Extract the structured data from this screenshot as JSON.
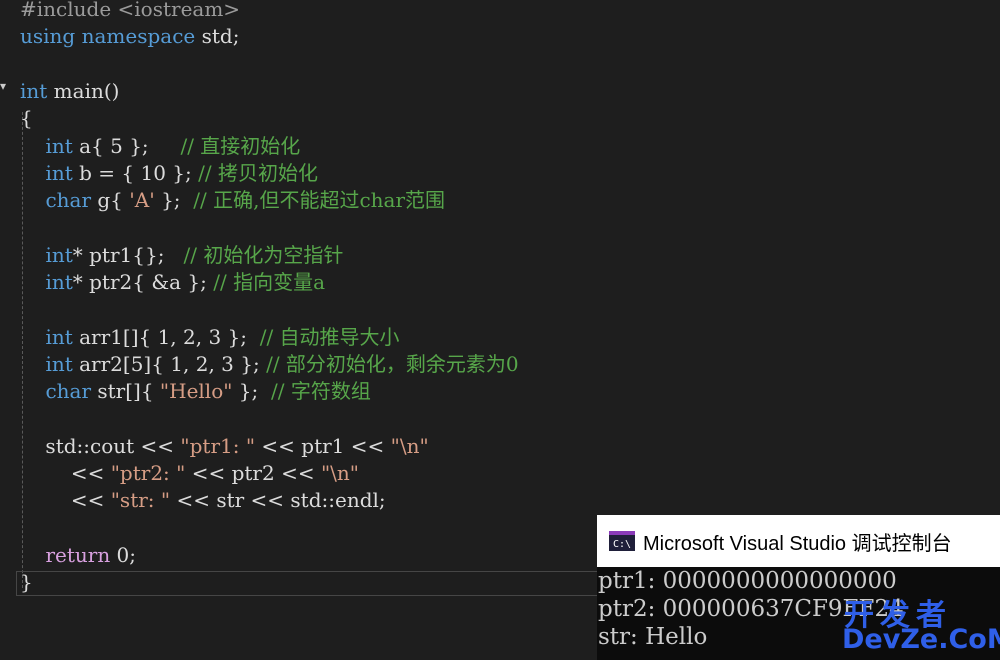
{
  "editor": {
    "lines": [
      {
        "tokens": [
          {
            "t": "#include <iostream>",
            "c": "pre"
          }
        ]
      },
      {
        "tokens": [
          {
            "t": "using",
            "c": "kw"
          },
          {
            "t": " ",
            "c": "ident"
          },
          {
            "t": "namespace",
            "c": "kw"
          },
          {
            "t": " std;",
            "c": "ident"
          }
        ]
      },
      {
        "tokens": []
      },
      {
        "tokens": [
          {
            "t": "int",
            "c": "kw"
          },
          {
            "t": " main()",
            "c": "ident"
          }
        ]
      },
      {
        "tokens": [
          {
            "t": "{",
            "c": "ident"
          }
        ]
      },
      {
        "tokens": [
          {
            "t": "    ",
            "c": "ident"
          },
          {
            "t": "int",
            "c": "kw"
          },
          {
            "t": " a{ 5 };     ",
            "c": "ident"
          },
          {
            "t": "// 直接初始化",
            "c": "cmt"
          }
        ]
      },
      {
        "tokens": [
          {
            "t": "    ",
            "c": "ident"
          },
          {
            "t": "int",
            "c": "kw"
          },
          {
            "t": " b = { 10 }; ",
            "c": "ident"
          },
          {
            "t": "// 拷贝初始化",
            "c": "cmt"
          }
        ]
      },
      {
        "tokens": [
          {
            "t": "    ",
            "c": "ident"
          },
          {
            "t": "char",
            "c": "kw"
          },
          {
            "t": " g{ ",
            "c": "ident"
          },
          {
            "t": "'A'",
            "c": "str"
          },
          {
            "t": " };  ",
            "c": "ident"
          },
          {
            "t": "// 正确,但不能超过char范围",
            "c": "cmt"
          }
        ]
      },
      {
        "tokens": []
      },
      {
        "tokens": [
          {
            "t": "    ",
            "c": "ident"
          },
          {
            "t": "int",
            "c": "kw"
          },
          {
            "t": "* ptr1{};   ",
            "c": "ident"
          },
          {
            "t": "// 初始化为空指针",
            "c": "cmt"
          }
        ]
      },
      {
        "tokens": [
          {
            "t": "    ",
            "c": "ident"
          },
          {
            "t": "int",
            "c": "kw"
          },
          {
            "t": "* ptr2{ &a }; ",
            "c": "ident"
          },
          {
            "t": "// 指向变量a",
            "c": "cmt"
          }
        ]
      },
      {
        "tokens": []
      },
      {
        "tokens": [
          {
            "t": "    ",
            "c": "ident"
          },
          {
            "t": "int",
            "c": "kw"
          },
          {
            "t": " arr1[]{ 1, 2, 3 };  ",
            "c": "ident"
          },
          {
            "t": "// 自动推导大小",
            "c": "cmt"
          }
        ]
      },
      {
        "tokens": [
          {
            "t": "    ",
            "c": "ident"
          },
          {
            "t": "int",
            "c": "kw"
          },
          {
            "t": " arr2[5]{ 1, 2, 3 }; ",
            "c": "ident"
          },
          {
            "t": "// 部分初始化，剩余元素为0",
            "c": "cmt"
          }
        ]
      },
      {
        "tokens": [
          {
            "t": "    ",
            "c": "ident"
          },
          {
            "t": "char",
            "c": "kw"
          },
          {
            "t": " str[]{ ",
            "c": "ident"
          },
          {
            "t": "\"Hello\"",
            "c": "str"
          },
          {
            "t": " };  ",
            "c": "ident"
          },
          {
            "t": "// 字符数组",
            "c": "cmt"
          }
        ]
      },
      {
        "tokens": []
      },
      {
        "tokens": [
          {
            "t": "    std::cout << ",
            "c": "ident"
          },
          {
            "t": "\"ptr1: \"",
            "c": "str"
          },
          {
            "t": " << ptr1 << ",
            "c": "ident"
          },
          {
            "t": "\"\\n\"",
            "c": "str"
          }
        ]
      },
      {
        "tokens": [
          {
            "t": "        << ",
            "c": "ident"
          },
          {
            "t": "\"ptr2: \"",
            "c": "str"
          },
          {
            "t": " << ptr2 << ",
            "c": "ident"
          },
          {
            "t": "\"\\n\"",
            "c": "str"
          }
        ]
      },
      {
        "tokens": [
          {
            "t": "        << ",
            "c": "ident"
          },
          {
            "t": "\"str: \"",
            "c": "str"
          },
          {
            "t": " << str << std::endl;",
            "c": "ident"
          }
        ]
      },
      {
        "tokens": []
      },
      {
        "tokens": [
          {
            "t": "    ",
            "c": "ident"
          },
          {
            "t": "return",
            "c": "ret"
          },
          {
            "t": " 0;",
            "c": "ident"
          }
        ]
      },
      {
        "tokens": [
          {
            "t": "}",
            "c": "ident"
          }
        ]
      }
    ]
  },
  "console": {
    "icon_text": "C:\\",
    "title": "Microsoft Visual Studio 调试控制台",
    "output": [
      "ptr1: 0000000000000000",
      "ptr2: 000000637CF9FF24",
      "str: Hello"
    ]
  },
  "watermark": {
    "top": "开发者",
    "bottom": "DevZe.CoM"
  }
}
